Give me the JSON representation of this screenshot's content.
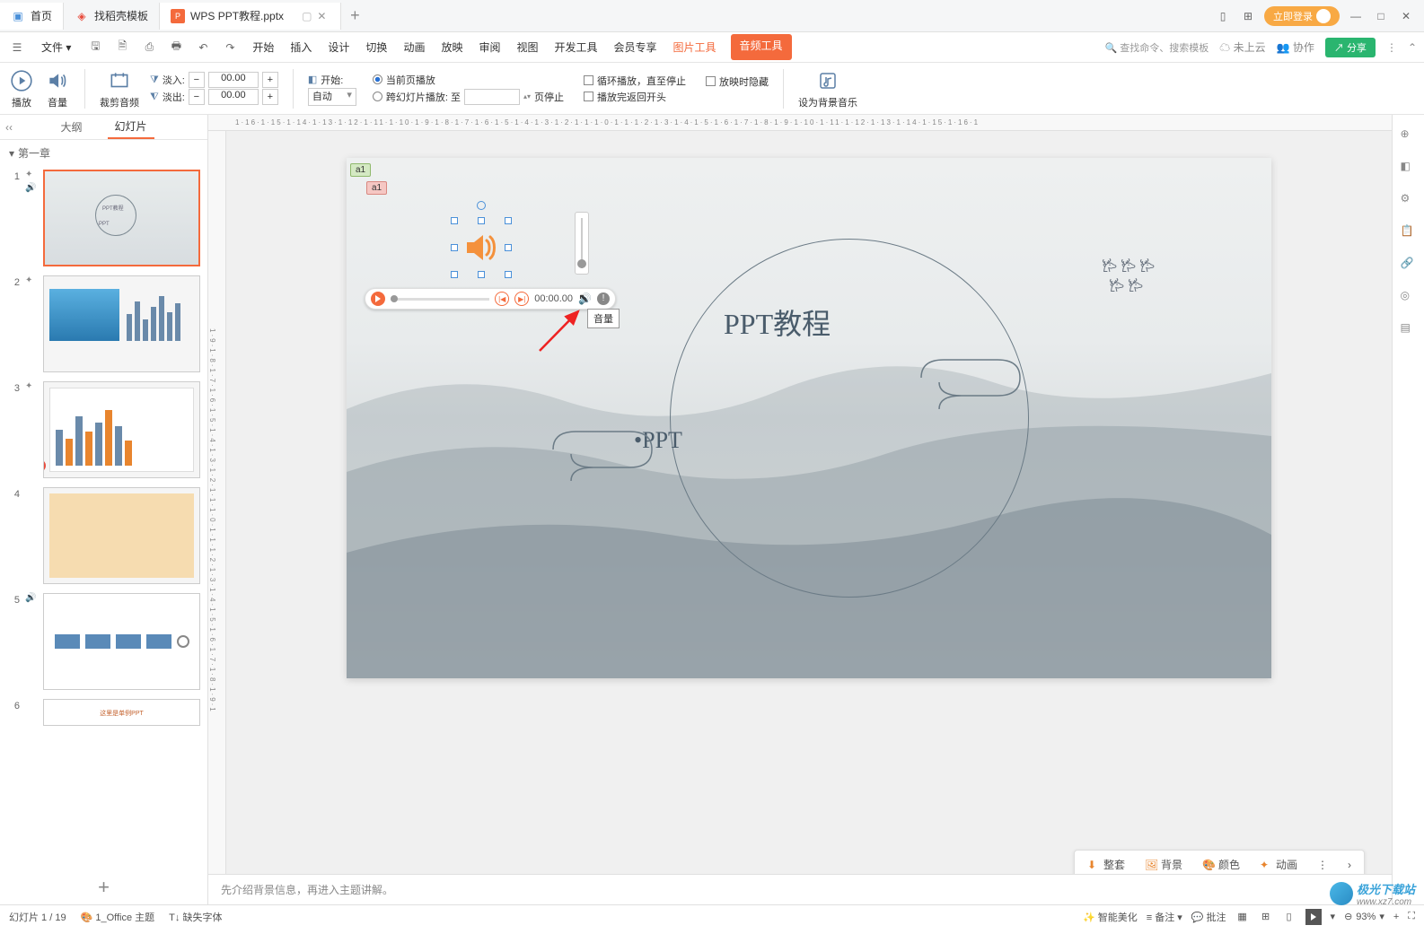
{
  "titlebar": {
    "home_tab": "首页",
    "template_tab": "找稻壳模板",
    "file_tab": "WPS PPT教程.pptx"
  },
  "login": {
    "label": "立即登录"
  },
  "window": {
    "min": "—",
    "max": "□",
    "close": "✕"
  },
  "menubar": {
    "file": "文件",
    "tabs": [
      "开始",
      "插入",
      "设计",
      "切换",
      "动画",
      "放映",
      "审阅",
      "视图",
      "开发工具",
      "会员专享"
    ],
    "pic_tool": "图片工具",
    "audio_tool": "音频工具",
    "search_hint": "查找命令、搜索模板",
    "cloud": "未上云",
    "collab": "协作",
    "share": "分享"
  },
  "ribbon": {
    "play": "播放",
    "volume": "音量",
    "trim": "裁剪音频",
    "fade_in_label": "淡入:",
    "fade_out_label": "淡出:",
    "fade_in_val": "00.00",
    "fade_out_val": "00.00",
    "start_label": "开始:",
    "auto": "自动",
    "current_page": "当前页播放",
    "cross_slides": "跨幻灯片播放: 至",
    "page_stop": "页停止",
    "loop": "循环播放，直至停止",
    "hide": "放映时隐藏",
    "rewind": "播放完返回开头",
    "bgm": "设为背景音乐"
  },
  "panel": {
    "outline_tab": "大纲",
    "slides_tab": "幻灯片",
    "chapter": "第一章"
  },
  "thumbs": {
    "numbers": [
      "1",
      "2",
      "3",
      "4",
      "5",
      "6"
    ],
    "th6_text": "这里是单例PPT"
  },
  "slide": {
    "comment1": "a1",
    "comment2": "a1",
    "title": "PPT教程",
    "subtitle": "•PPT",
    "player_time": "00:00.00",
    "tooltip": "音量"
  },
  "float_toolbar": {
    "replace": "整套",
    "bg": "背景",
    "color": "颜色",
    "anim": "动画"
  },
  "notes": {
    "text": "先介绍背景信息，再进入主题讲解。"
  },
  "statusbar": {
    "slide_pos": "幻灯片 1 / 19",
    "theme": "1_Office 主题",
    "missing_font": "缺失字体",
    "beautify": "智能美化",
    "notes_btn": "备注",
    "comments_btn": "批注",
    "zoom": "93%"
  },
  "ruler_h": "1·16·1·15·1·14·1·13·1·12·1·11·1·10·1·9·1·8·1·7·1·6·1·5·1·4·1·3·1·2·1·1·1·0·1·1·1·2·1·3·1·4·1·5·1·6·1·7·1·8·1·9·1·10·1·11·1·12·1·13·1·14·1·15·1·16·1",
  "ruler_v": "1·9·1·8·1·7·1·6·1·5·1·4·1·3·1·2·1·1·1·0·1·1·1·2·1·3·1·4·1·5·1·6·1·7·1·8·1·9·1",
  "watermark": {
    "text1": "极光下载站",
    "text2": "www.xz7.com"
  }
}
